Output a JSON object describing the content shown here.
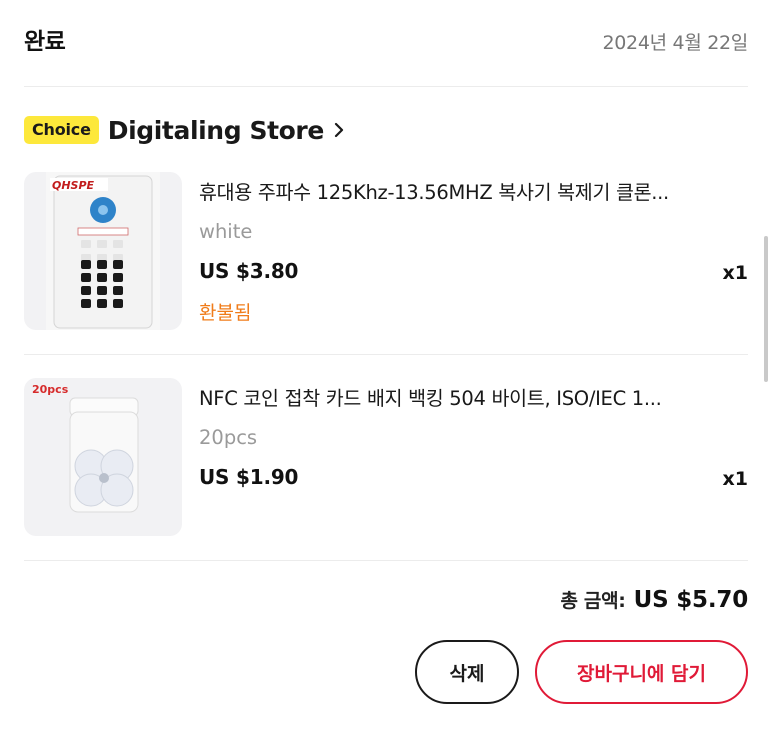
{
  "order": {
    "status": "완료",
    "date": "2024년 4월 22일"
  },
  "store": {
    "badge": "Choice",
    "name": "Digitaling Store",
    "chevron_icon": "chevron-right-icon"
  },
  "items": [
    {
      "title": "휴대용 주파수 125Khz-13.56MHZ 복사기 복제기 클론...",
      "variant": "white",
      "price": "US $3.80",
      "quantity": "x1",
      "status": "환불됨",
      "thumbnail_brand": "QHSPE",
      "status_color": "#f07c1a"
    },
    {
      "title": "NFC 코인 접착 카드 배지 백킹 504 바이트, ISO/IEC 1...",
      "variant": "20pcs",
      "price": "US $1.90",
      "quantity": "x1",
      "thumbnail_tag": "20pcs"
    }
  ],
  "summary": {
    "total_label": "총 금액:",
    "total_value": "US $5.70"
  },
  "actions": {
    "delete_label": "삭제",
    "add_to_cart_label": "장바구니에 담기"
  },
  "colors": {
    "accent": "#e01a37",
    "choice_badge": "#fde83b",
    "refund_status": "#f07c1a"
  }
}
